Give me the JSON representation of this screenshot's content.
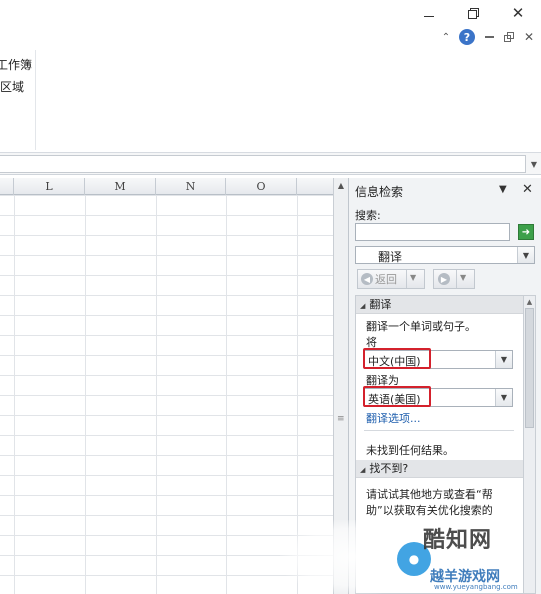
{
  "window": {
    "minimize_icon": "minimize-icon",
    "restore_icon": "restore-icon",
    "close_icon": "close-icon"
  },
  "ribbon": {
    "group_label_1": "工作簿",
    "group_label_2": "区域"
  },
  "sheet": {
    "columns": [
      "L",
      "M",
      "N",
      "O"
    ]
  },
  "pane": {
    "title": "信息检索",
    "search_label": "搜索:",
    "search_value": "",
    "service_selected": "翻译",
    "back_label": "返回",
    "translate_section": {
      "header": "翻译",
      "instruction": "翻译一个单词或句子。",
      "from_label": "将",
      "from_value": "中文(中国)",
      "to_label": "翻译为",
      "to_value": "英语(美国)",
      "options_link": "翻译选项..."
    },
    "no_results": "未找到任何结果。",
    "not_found_section": {
      "header": "找不到?",
      "help_line_1": "请试试其他地方或查看“帮",
      "help_line_2": "助”以获取有关优化搜索的"
    }
  },
  "watermark": {
    "brand": "酷知网",
    "brand2": "越羊游戏网",
    "url": "www.yueyangbang.com"
  },
  "colors": {
    "highlight": "#d4212c",
    "link": "#1f5fae",
    "go_button": "#3da04a"
  }
}
